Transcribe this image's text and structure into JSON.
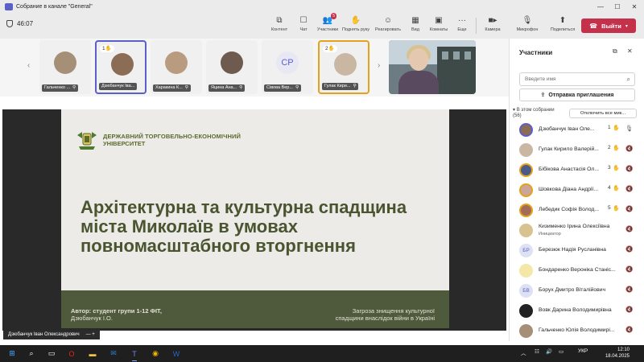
{
  "window": {
    "title": "Собрание в канале \"General\""
  },
  "toolbar": {
    "timer": "46:07",
    "items": [
      {
        "label": "Контент",
        "icon": "share-content-icon"
      },
      {
        "label": "Чат",
        "icon": "chat-icon"
      },
      {
        "label": "Участники",
        "icon": "people-icon",
        "badge": "5"
      },
      {
        "label": "Поднять руку",
        "icon": "hand-icon"
      },
      {
        "label": "Реагировать",
        "icon": "smile-icon"
      },
      {
        "label": "Вид",
        "icon": "grid-icon"
      },
      {
        "label": "Комнаты",
        "icon": "rooms-icon"
      },
      {
        "label": "Еще",
        "icon": "more-icon"
      },
      {
        "label": "Камера",
        "icon": "camera-icon"
      },
      {
        "label": "Микрофон",
        "icon": "mic-icon"
      },
      {
        "label": "Поделиться",
        "icon": "share-icon"
      }
    ],
    "leave_label": "Выйти"
  },
  "strip": {
    "tiles": [
      {
        "name": "Гальченко ...",
        "hand": "",
        "initials": ""
      },
      {
        "name": "Дзюбанчук Іва...",
        "hand": "1",
        "initials": ""
      },
      {
        "name": "Харакина К...",
        "hand": "",
        "initials": ""
      },
      {
        "name": "Яцина Ана...",
        "hand": "",
        "initials": ""
      },
      {
        "name": "Сівова Вер...",
        "hand": "",
        "initials": "CP"
      },
      {
        "name": "Гулак Кири...",
        "hand": "2",
        "initials": ""
      }
    ]
  },
  "slide": {
    "university_line1": "ДЕРЖАВНИЙ ТОРГОВЕЛЬНО-ЕКОНОМІЧНИЙ",
    "university_line2": "УНІВЕРСИТЕТ",
    "title": "Архітектурна та культурна спадщина міста Миколаїв в умовах повномасштабного вторгнення",
    "author_line1": "Автор: студент групи 1-12 ФІТ,",
    "author_line2": "Дзюбанчук І.О.",
    "topic_line1": "Загроза знищення культурної",
    "topic_line2": "спадщини внаслідок війни в Україні"
  },
  "sharer": {
    "name": "Дзюбанчук Іван Олександрович",
    "actions": "— +"
  },
  "panel": {
    "title": "Участники",
    "search_placeholder": "Введите имя",
    "invite_label": "Отправка приглашения",
    "section_label": "В этом собрании",
    "section_count": "(56)",
    "mute_all_label": "Отключить все мик...",
    "participants": [
      {
        "name": "Дзюбанчук Іван Оле...",
        "role": "",
        "num": "1",
        "hand": true,
        "initials": "",
        "mic": "on"
      },
      {
        "name": "Гулак Кирило Валерій...",
        "role": "",
        "num": "2",
        "hand": true,
        "initials": "",
        "mic": "muted"
      },
      {
        "name": "Бібікова Анастасія Ол...",
        "role": "",
        "num": "3",
        "hand": true,
        "initials": "",
        "mic": "muted"
      },
      {
        "name": "Шовкова Діана Андрії...",
        "role": "",
        "num": "4",
        "hand": true,
        "initials": "",
        "mic": "muted"
      },
      {
        "name": "Лебедик Софія Волод...",
        "role": "",
        "num": "5",
        "hand": true,
        "initials": "",
        "mic": "muted"
      },
      {
        "name": "Кизименко Ірина Олексіївна",
        "role": "Инициатор",
        "num": "",
        "hand": false,
        "initials": "",
        "mic": "muted"
      },
      {
        "name": "Березюк Надія Русланівна",
        "role": "",
        "num": "",
        "hand": false,
        "initials": "БР",
        "mic": "muted"
      },
      {
        "name": "Бондаренко Вероніка Станіс...",
        "role": "",
        "num": "",
        "hand": false,
        "initials": "",
        "mic": "muted"
      },
      {
        "name": "Борух Дмитро Віталійович",
        "role": "",
        "num": "",
        "hand": false,
        "initials": "БВ",
        "mic": "muted"
      },
      {
        "name": "Вовк Дарина Володимирівна",
        "role": "",
        "num": "",
        "hand": false,
        "initials": "",
        "mic": "muted"
      },
      {
        "name": "Гальченко Юлія Володимирі...",
        "role": "",
        "num": "",
        "hand": false,
        "initials": "",
        "mic": "muted"
      }
    ]
  },
  "taskbar": {
    "lang": "УКР",
    "time": "12:10",
    "date": "18.04.2025"
  },
  "colors": {
    "accent": "#5b5fc7",
    "leave": "#c4314b",
    "raised_hand": "#e3a21a",
    "slide_green": "#4f5a3c"
  }
}
